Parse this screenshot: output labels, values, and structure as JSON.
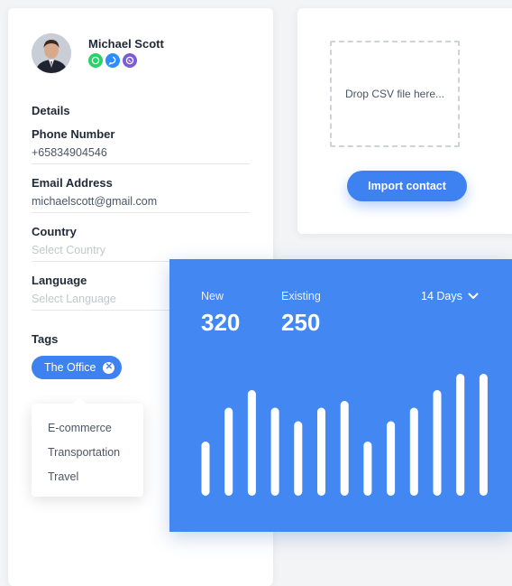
{
  "contact": {
    "name": "Michael Scott",
    "social_icons": [
      "whatsapp-icon",
      "messenger-icon",
      "viber-icon"
    ],
    "social_colors": [
      "#25d366",
      "#2d8cff",
      "#7b5cd6"
    ],
    "details_title": "Details",
    "phone": {
      "label": "Phone Number",
      "value": "+65834904546"
    },
    "email": {
      "label": "Email Address",
      "value": "michaelscott@gmail.com"
    },
    "country": {
      "label": "Country",
      "placeholder": "Select Country"
    },
    "language": {
      "label": "Language",
      "placeholder": "Select Language"
    },
    "tags_title": "Tags",
    "tag": "The Office",
    "tag_options": [
      "E-commerce",
      "Transportation",
      "Travel"
    ]
  },
  "import": {
    "dropzone_text": "Drop CSV file here...",
    "button_label": "Import contact"
  },
  "stats": {
    "new_label": "New",
    "new_value": "320",
    "existing_label": "Existing",
    "existing_value": "250",
    "period_label": "14 Days",
    "accent": "#4388f2"
  },
  "chart_data": {
    "type": "bar",
    "categories": [],
    "values": [
      40,
      65,
      78,
      65,
      55,
      65,
      70,
      40,
      55,
      65,
      78,
      90,
      90
    ],
    "ylim": [
      0,
      100
    ],
    "grid": false,
    "title": "",
    "xlabel": "",
    "ylabel": ""
  }
}
